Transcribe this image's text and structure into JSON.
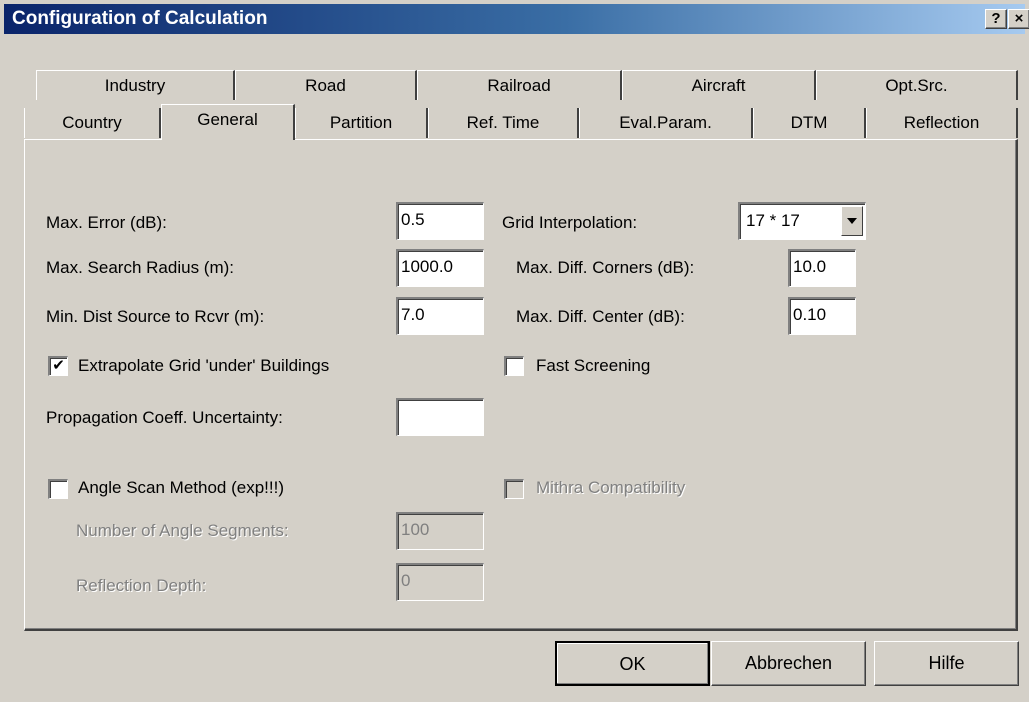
{
  "window": {
    "title": "Configuration of Calculation",
    "help_glyph": "?",
    "close_glyph": "×"
  },
  "tabs_back_row": [
    "Industry",
    "Road",
    "Railroad",
    "Aircraft",
    "Opt.Src."
  ],
  "tabs_front_row": [
    "Country",
    "General",
    "Partition",
    "Ref. Time",
    "Eval.Param.",
    "DTM",
    "Reflection"
  ],
  "selected_tab": "General",
  "general": {
    "max_error": {
      "label": "Max. Error (dB):",
      "value": "0.5"
    },
    "max_search_radius": {
      "label": "Max. Search Radius (m):",
      "value": "1000.0"
    },
    "min_dist_source": {
      "label": "Min. Dist Source to Rcvr (m):",
      "value": "7.0"
    },
    "extrapolate_grid": {
      "label": "Extrapolate Grid 'under' Buildings",
      "checked": true,
      "check_glyph": "✔"
    },
    "propagation_uncertainty": {
      "label": "Propagation Coeff. Uncertainty:",
      "value": ""
    },
    "angle_scan": {
      "label": "Angle Scan Method (exp!!!)",
      "checked": false
    },
    "angle_segments": {
      "label": "Number of Angle Segments:",
      "value": "100",
      "disabled": true
    },
    "reflection_depth": {
      "label": "Reflection Depth:",
      "value": "0",
      "disabled": true
    },
    "grid_interpolation": {
      "label": "Grid Interpolation:",
      "value": "17 * 17"
    },
    "max_diff_corners": {
      "label": "Max. Diff. Corners (dB):",
      "value": "10.0"
    },
    "max_diff_center": {
      "label": "Max. Diff. Center (dB):",
      "value": "0.10"
    },
    "fast_screening": {
      "label": "Fast Screening",
      "checked": false
    },
    "mithra": {
      "label": "Mithra Compatibility",
      "checked": false,
      "disabled": true
    }
  },
  "buttons": {
    "ok": "OK",
    "cancel": "Abbrechen",
    "help": "Hilfe"
  }
}
